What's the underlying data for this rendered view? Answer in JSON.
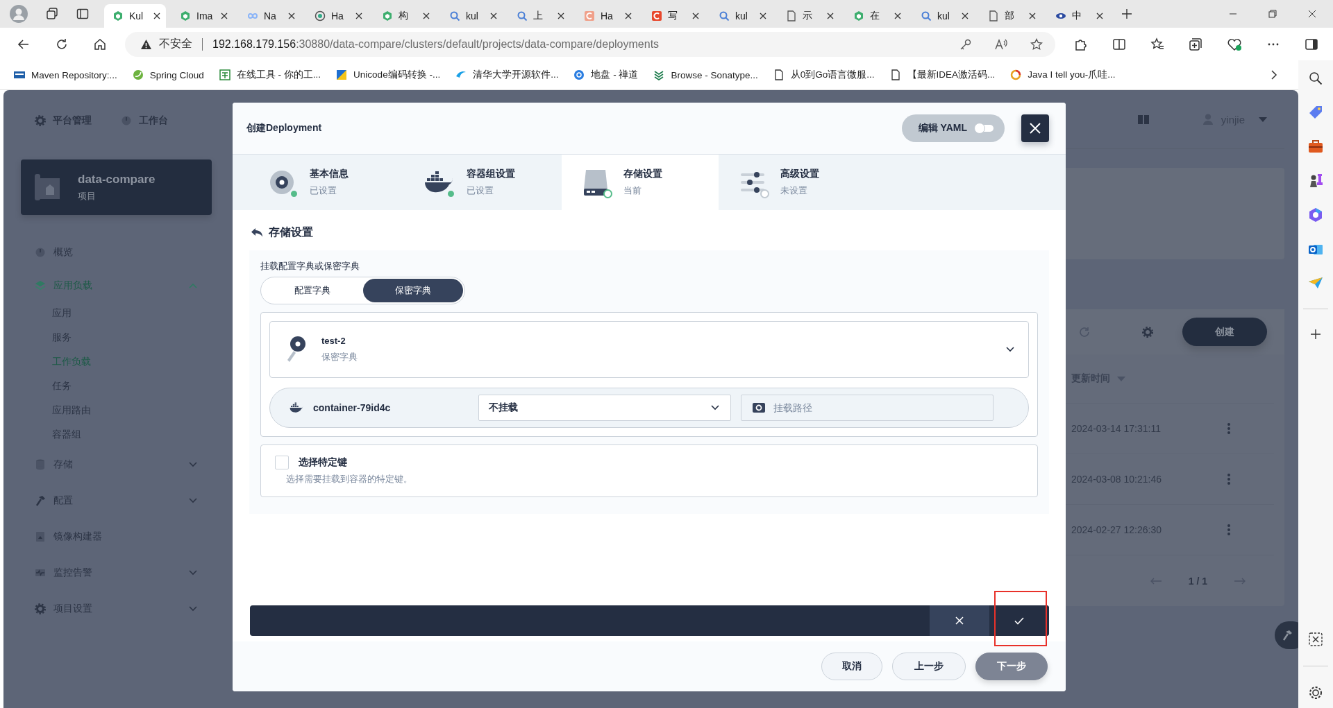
{
  "browser": {
    "tabs": [
      {
        "title": "Kul",
        "selected": true
      },
      {
        "title": "Ima",
        "selected": false
      },
      {
        "title": "Na",
        "selected": false
      },
      {
        "title": "Ha",
        "selected": false
      },
      {
        "title": "构",
        "selected": false
      },
      {
        "title": "kul",
        "selected": false
      },
      {
        "title": "上",
        "selected": false
      },
      {
        "title": "Ha",
        "selected": false
      },
      {
        "title": "写",
        "selected": false
      },
      {
        "title": "kul",
        "selected": false
      },
      {
        "title": "示",
        "selected": false
      },
      {
        "title": "在",
        "selected": false
      },
      {
        "title": "kul",
        "selected": false
      },
      {
        "title": "部",
        "selected": false
      },
      {
        "title": "中",
        "selected": false
      }
    ],
    "address": {
      "security": "不安全",
      "host": "192.168.179.156",
      "path": ":30880/data-compare/clusters/default/projects/data-compare/deployments"
    },
    "bookmarks": [
      "Maven Repository:...",
      "Spring Cloud",
      "在线工具 - 你的工...",
      "Unicode编码转换 -...",
      "清华大学开源软件...",
      "地盘 - 禅道",
      "Browse - Sonatype...",
      "从0到Go语言微服...",
      "【最新IDEA激活码...",
      "Java I tell you-爪哇..."
    ]
  },
  "top_nav": [
    "平台管理",
    "工作台"
  ],
  "project": {
    "name": "data-compare",
    "type": "项目"
  },
  "sidebar": [
    {
      "label": "概览",
      "kind": "link"
    },
    {
      "label": "应用负载",
      "kind": "group",
      "expanded": true,
      "children": [
        {
          "label": "应用",
          "selected": false
        },
        {
          "label": "服务",
          "selected": false
        },
        {
          "label": "工作负载",
          "selected": true
        },
        {
          "label": "任务",
          "selected": false
        },
        {
          "label": "应用路由",
          "selected": false
        },
        {
          "label": "容器组",
          "selected": false
        }
      ]
    },
    {
      "label": "存储",
      "kind": "group",
      "expanded": false
    },
    {
      "label": "配置",
      "kind": "group",
      "expanded": false
    },
    {
      "label": "镜像构建器",
      "kind": "link"
    },
    {
      "label": "监控告警",
      "kind": "group",
      "expanded": false
    },
    {
      "label": "项目设置",
      "kind": "group",
      "expanded": false
    }
  ],
  "header": {
    "user": "yinjie"
  },
  "toolbar": {
    "create": "创建"
  },
  "table": {
    "columns": [
      "更新时间"
    ],
    "rows": [
      {
        "updated": "2024-03-14 17:31:11"
      },
      {
        "updated": "2024-03-08 10:21:46"
      },
      {
        "updated": "2024-02-27 12:26:30"
      }
    ]
  },
  "pagination": {
    "page": "1 / 1"
  },
  "modal": {
    "title": "创建Deployment",
    "yaml_toggle": {
      "label": "编辑 YAML",
      "on": false
    },
    "steps": [
      {
        "title": "基本信息",
        "status": "已设置",
        "completed": true,
        "selected": false
      },
      {
        "title": "容器组设置",
        "status": "已设置",
        "completed": true,
        "selected": false
      },
      {
        "title": "存储设置",
        "status": "当前",
        "completed": false,
        "selected": true
      },
      {
        "title": "高级设置",
        "status": "未设置",
        "completed": false,
        "selected": false
      }
    ],
    "section_title": "存储设置",
    "mount_label": "挂载配置字典或保密字典",
    "source_tabs": [
      {
        "label": "配置字典",
        "selected": false
      },
      {
        "label": "保密字典",
        "selected": true
      }
    ],
    "resource": {
      "name": "test-2",
      "type": "保密字典"
    },
    "containers": [
      {
        "name": "container-79id4c",
        "mode": "不挂载",
        "path_placeholder": "挂载路径"
      }
    ],
    "specific_keys": {
      "label": "选择特定键",
      "hint": "选择需要挂载到容器的特定键。",
      "checked": false
    },
    "buttons": [
      {
        "label": "取消",
        "kind": "default"
      },
      {
        "label": "上一步",
        "kind": "default"
      },
      {
        "label": "下一步",
        "kind": "primary"
      }
    ]
  }
}
